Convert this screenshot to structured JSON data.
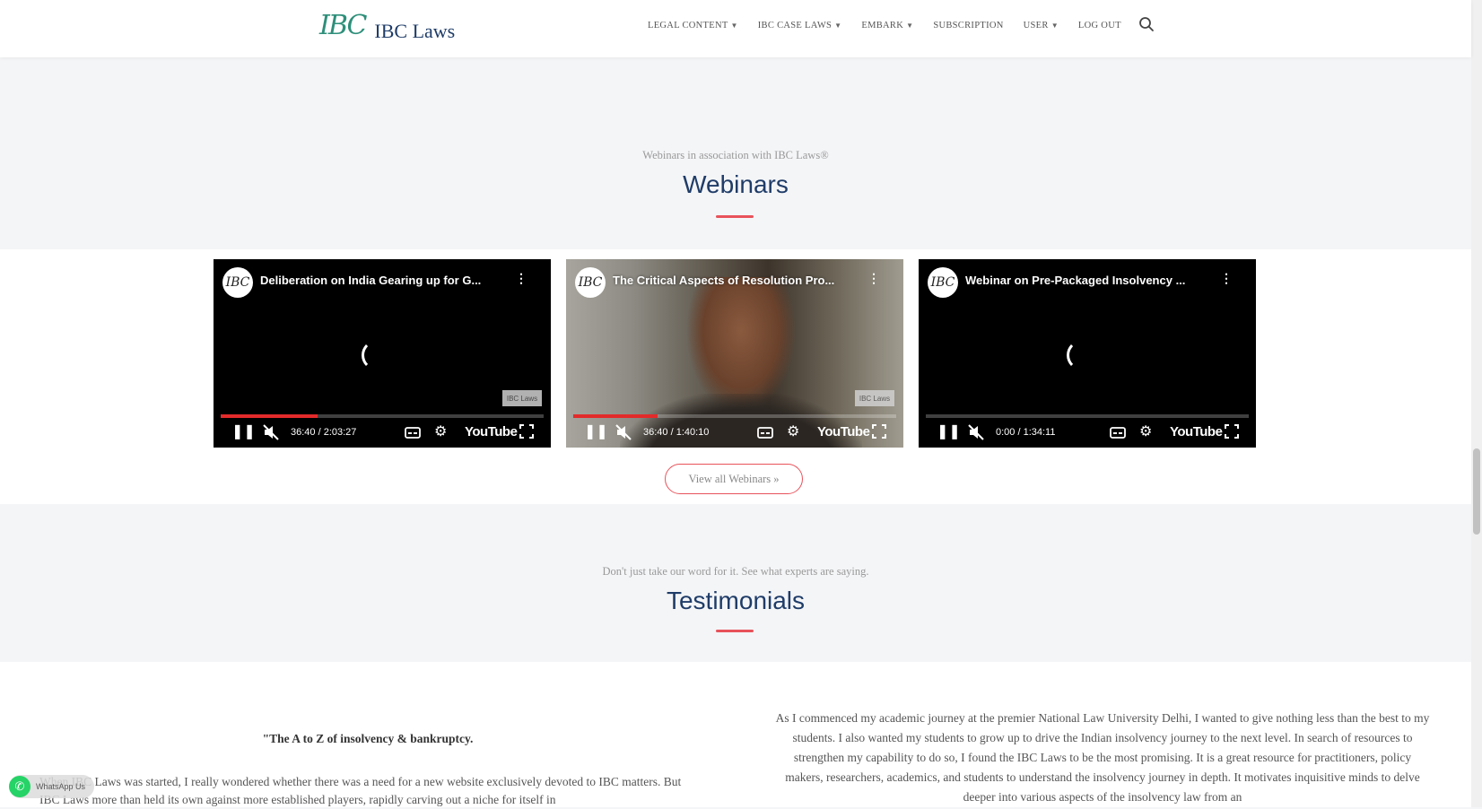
{
  "header": {
    "logo_mark": "IBC",
    "logo_text": "IBC Laws",
    "nav": [
      {
        "label": "Legal Content",
        "has_caret": true
      },
      {
        "label": "IBC Case Laws",
        "has_caret": true
      },
      {
        "label": "Embark",
        "has_caret": true
      },
      {
        "label": "Subscription",
        "has_caret": false
      },
      {
        "label": "User",
        "has_caret": true
      },
      {
        "label": "Log Out",
        "has_caret": false
      }
    ],
    "search_icon": "search-icon"
  },
  "webinars": {
    "subtitle": "Webinars in association with IBC Laws®",
    "title": "Webinars",
    "videos": [
      {
        "title": "Deliberation on India Gearing up for G...",
        "time": "36:40 / 2:03:27",
        "progress": 0.3,
        "channel_badge": "IBC",
        "watermark": "IBC Laws",
        "youtube_label": "YouTube"
      },
      {
        "title": "The Critical Aspects of Resolution Pro...",
        "time": "36:40 / 1:40:10",
        "progress": 0.26,
        "channel_badge": "IBC",
        "watermark": "IBC Laws",
        "youtube_label": "YouTube"
      },
      {
        "title": "Webinar on Pre-Packaged Insolvency ...",
        "time": "0:00 / 1:34:11",
        "progress": 0.0,
        "channel_badge": "IBC",
        "watermark": "",
        "youtube_label": "YouTube"
      }
    ],
    "view_all_label": "View all Webinars »"
  },
  "testimonials": {
    "subtitle": "Don't just take our word for it. See what experts are saying.",
    "title": "Testimonials",
    "left_heading": "\"The A to Z of insolvency & bankruptcy.",
    "left_body": "When IBC Laws was started, I really wondered whether there was a need for a new website exclusively devoted to IBC matters. But IBC Laws more than held its own against more established players, rapidly carving out a niche for itself in",
    "right_body": "As I commenced my academic journey at the premier National Law University Delhi, I wanted to give nothing less than the best to my students. I also wanted my students to grow up to drive the Indian insolvency journey to the next level. In search of resources to strengthen my capability to do so, I found the IBC Laws to be the most promising. It is a great resource for practitioners, policy makers, researchers, academics, and students to understand the insolvency journey in depth. It motivates inquisitive minds to delve deeper into various aspects of the insolvency law from an"
  },
  "whatsapp": {
    "label": "WhatsApp Us"
  },
  "colors": {
    "brand_navy": "#1f3c68",
    "accent_red": "#e8525a",
    "logo_green": "#2e8f7a",
    "progress_red": "#e32a2a"
  }
}
